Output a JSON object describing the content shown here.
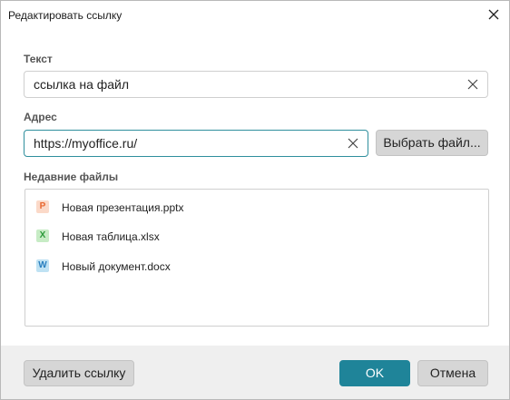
{
  "window": {
    "title": "Редактировать ссылку"
  },
  "text_field": {
    "label": "Текст",
    "value": "ссылка на файл"
  },
  "address_field": {
    "label": "Адрес",
    "value": "https://myoffice.ru/"
  },
  "choose_file_label": "Выбрать файл...",
  "recent_files": {
    "label": "Недавние файлы",
    "items": [
      {
        "name": "Новая презентация.pptx",
        "letter": "P",
        "icon": "presentation-file-icon",
        "color": "#e8672f",
        "bg": "#fbd9c8"
      },
      {
        "name": "Новая таблица.xlsx",
        "letter": "X",
        "icon": "spreadsheet-file-icon",
        "color": "#2c9a3a",
        "bg": "#c7ecc5"
      },
      {
        "name": "Новый документ.docx",
        "letter": "W",
        "icon": "document-file-icon",
        "color": "#2a7fbf",
        "bg": "#bfe2f3"
      }
    ]
  },
  "footer": {
    "delete_label": "Удалить ссылку",
    "ok_label": "OK",
    "cancel_label": "Отмена"
  }
}
